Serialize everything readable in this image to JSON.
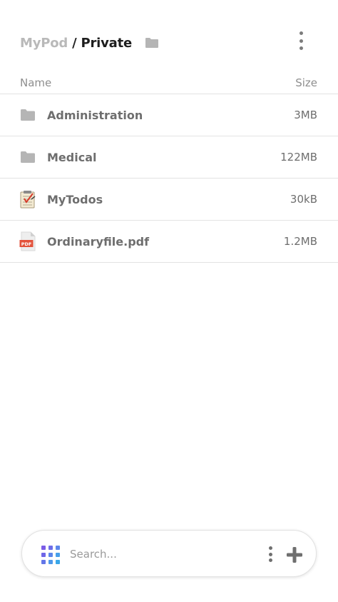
{
  "header": {
    "breadcrumb_root": "MyPod",
    "breadcrumb_separator": "/",
    "breadcrumb_current": "Private",
    "folder_icon": "folder-icon",
    "menu_icon": "more-vertical-icon"
  },
  "columns": {
    "name": "Name",
    "size": "Size"
  },
  "files": [
    {
      "name": "Administration",
      "size": "3MB",
      "icon": "folder-icon"
    },
    {
      "name": "Medical",
      "size": "122MB",
      "icon": "folder-icon"
    },
    {
      "name": "MyTodos",
      "size": "30kB",
      "icon": "todo-notepad-icon"
    },
    {
      "name": "Ordinaryfile.pdf",
      "size": "1.2MB",
      "icon": "pdf-file-icon"
    }
  ],
  "search": {
    "placeholder": "Search...",
    "value": "",
    "apps_icon": "apps-grid-icon",
    "menu_icon": "more-vertical-icon",
    "add_icon": "plus-icon"
  },
  "colors": {
    "folder_gray": "#b5b5b5",
    "pdf_red": "#e3533c",
    "apps_purple": "#7b5ce6",
    "apps_blue": "#3aa7e8",
    "divider": "#e3e3e3"
  }
}
